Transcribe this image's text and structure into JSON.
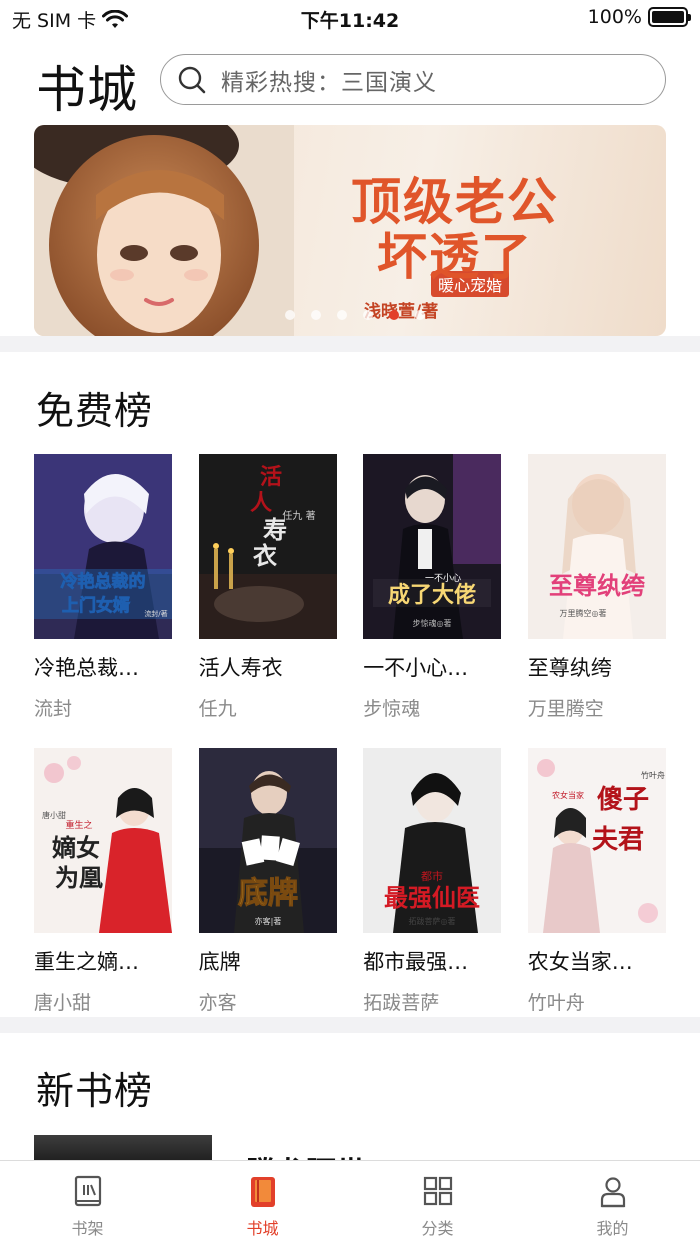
{
  "status_bar": {
    "carrier": "无 SIM 卡",
    "time": "下午11:42",
    "battery": "100%",
    "battery_level": 1.0
  },
  "header": {
    "title": "书城",
    "search_placeholder": "精彩热搜：三国演义"
  },
  "banner": {
    "tag": "暖心宠婚",
    "title_line1": "顶级老公",
    "title_line2": "坏透了",
    "author": "浅晓萱/著",
    "dot_count": 6,
    "active_dot": 4
  },
  "free_ranking": {
    "title": "免费榜",
    "books": [
      {
        "title": "冷艳总裁…",
        "author": "流封",
        "cover_text": "冷艳总裁的上门女婿",
        "cover_sub": "流封/著"
      },
      {
        "title": "活人寿衣",
        "author": "任九",
        "cover_text": "活人寿衣",
        "cover_sub": "任九 著"
      },
      {
        "title": "一不小心…",
        "author": "步惊魂",
        "cover_text": "成了大佬",
        "cover_sub": "步惊魂◎著",
        "cover_tag": "一不小心"
      },
      {
        "title": "至尊纨绔",
        "author": "万里腾空",
        "cover_text": "至尊纨绔",
        "cover_sub": "万里腾空◎著"
      },
      {
        "title": "重生之嫡…",
        "author": "唐小甜",
        "cover_text": "嫡女为凰",
        "cover_sub": "唐小甜",
        "cover_tag": "重生之"
      },
      {
        "title": "底牌",
        "author": "亦客",
        "cover_text": "底牌",
        "cover_sub": "亦客|著"
      },
      {
        "title": "都市最强…",
        "author": "拓跋菩萨",
        "cover_text": "最强仙医",
        "cover_sub": "拓跋菩萨◎著",
        "cover_tag": "都市"
      },
      {
        "title": "农女当家…",
        "author": "竹叶舟",
        "cover_text": "傻子夫君",
        "cover_sub": "竹叶舟",
        "cover_tag": "农女当家"
      }
    ]
  },
  "new_ranking": {
    "title": "新书榜",
    "peek_title": "腾龙蹶世"
  },
  "tab_bar": {
    "tabs": [
      {
        "label": "书架",
        "icon": "bookshelf-icon"
      },
      {
        "label": "书城",
        "icon": "bookstore-icon"
      },
      {
        "label": "分类",
        "icon": "category-grid-icon"
      },
      {
        "label": "我的",
        "icon": "profile-icon"
      }
    ],
    "active": "书城"
  },
  "colors": {
    "accent": "#e2402a",
    "muted_text": "#8a8a8a",
    "separator": "#f2f2f4"
  }
}
